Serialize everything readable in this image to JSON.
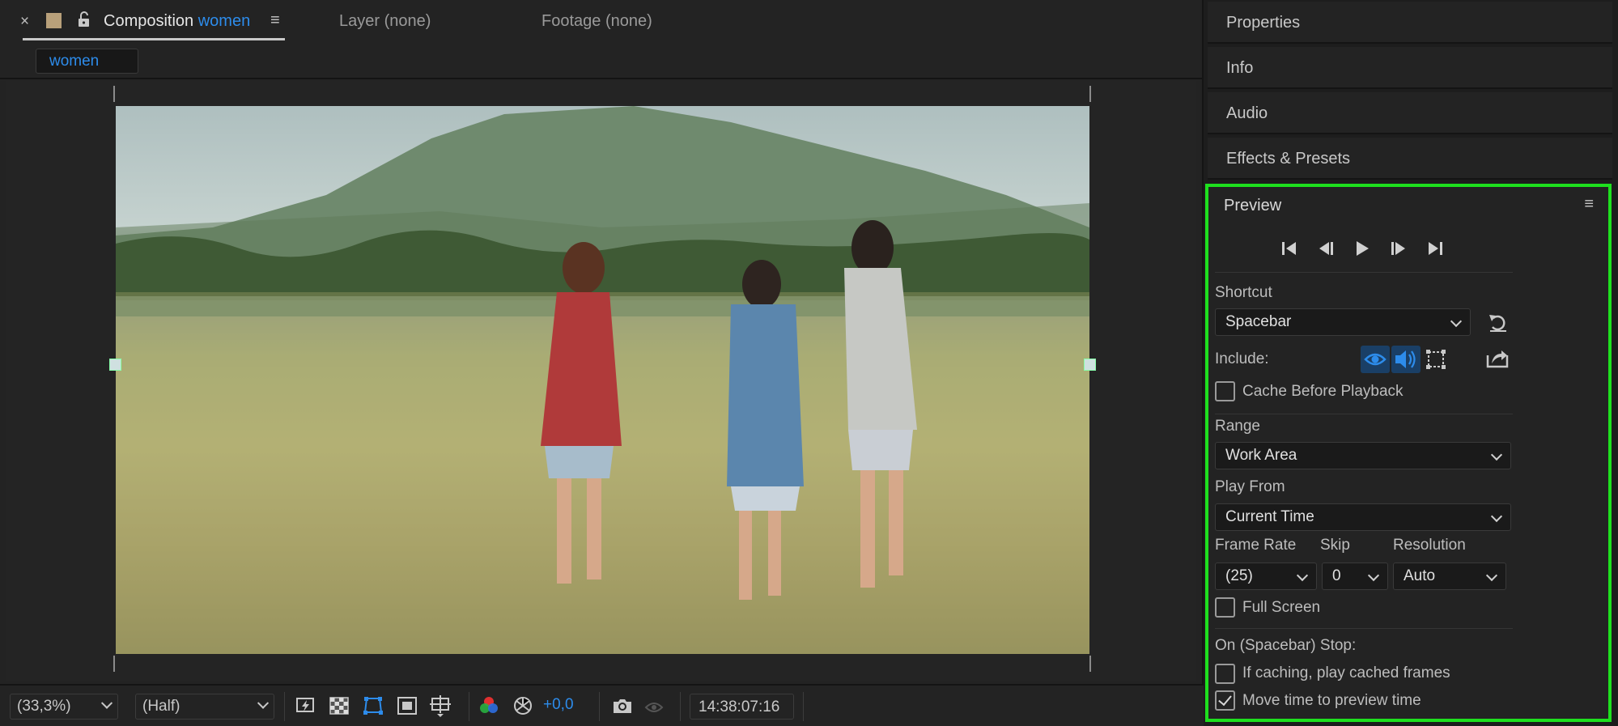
{
  "composition_tab": {
    "close": "×",
    "title_prefix": "Composition",
    "title_name": "women",
    "menu": "≡"
  },
  "layer_tab": "Layer (none)",
  "footage_tab": "Footage (none)",
  "comp_chip": "women",
  "toolbar": {
    "magnification": "(33,3%)",
    "resolution": "(Half)",
    "exposure": "+0,0",
    "timecode": "14:38:07:16"
  },
  "dock": {
    "properties": "Properties",
    "info": "Info",
    "audio": "Audio",
    "effects": "Effects & Presets"
  },
  "preview": {
    "title": "Preview",
    "menu": "≡",
    "shortcut_label": "Shortcut",
    "shortcut_value": "Spacebar",
    "include_label": "Include:",
    "cache_before_playback": "Cache Before Playback",
    "range_label": "Range",
    "range_value": "Work Area",
    "play_from_label": "Play From",
    "play_from_value": "Current Time",
    "frame_rate_label": "Frame Rate",
    "skip_label": "Skip",
    "resolution_label": "Resolution",
    "frame_rate_value": "(25)",
    "skip_value": "0",
    "resolution_value": "Auto",
    "full_screen": "Full Screen",
    "on_stop_label": "On (Spacebar) Stop:",
    "if_caching": "If caching, play cached frames",
    "move_time": "Move time to preview time",
    "checks": {
      "cache_before_playback": false,
      "full_screen": false,
      "if_caching": false,
      "move_time": true
    }
  },
  "colors": {
    "accent_blue": "#2d8ceb",
    "highlight_border": "#1ee01e"
  }
}
